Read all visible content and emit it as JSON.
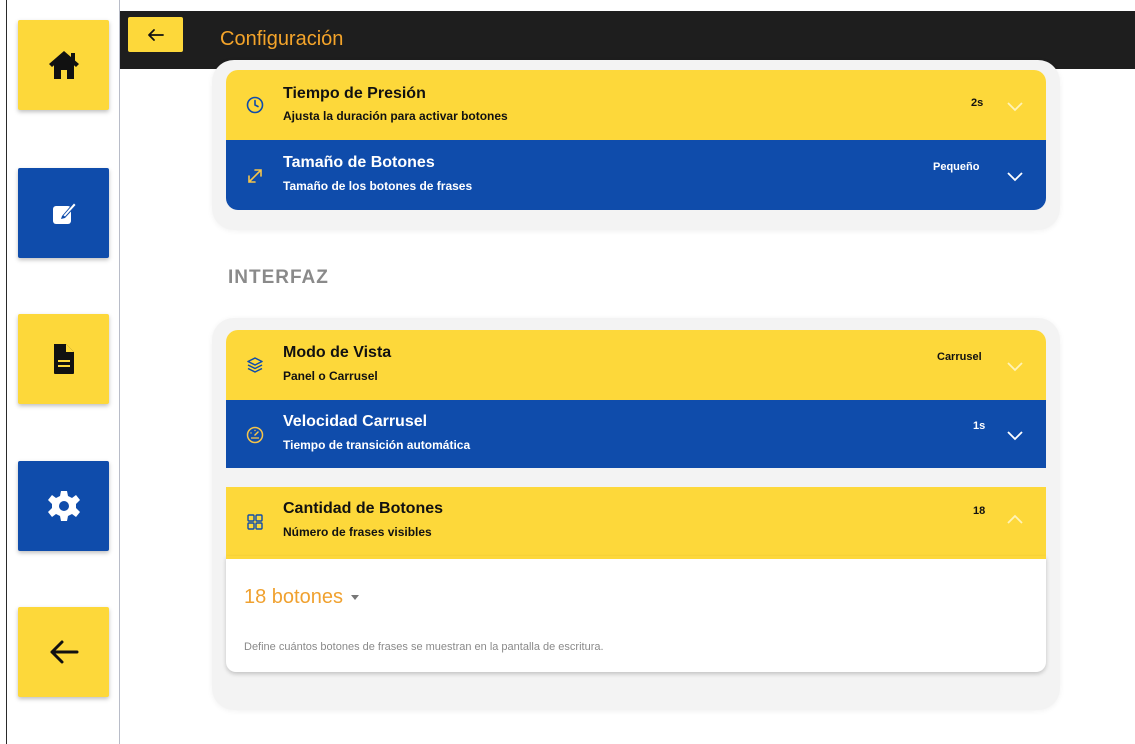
{
  "colors": {
    "accent_yellow": "#fdd83a",
    "accent_blue": "#0f4cab",
    "title_orange": "#f4a42a",
    "topbar": "#1e1e1e"
  },
  "sidebar": {
    "items": [
      {
        "name": "home",
        "icon": "home-icon"
      },
      {
        "name": "edit",
        "icon": "edit-icon"
      },
      {
        "name": "document",
        "icon": "document-icon"
      },
      {
        "name": "settings",
        "icon": "gear-icon"
      },
      {
        "name": "back",
        "icon": "arrow-left-icon"
      }
    ]
  },
  "header": {
    "title": "Configuración",
    "back_icon": "arrow-left-icon"
  },
  "section_top": {
    "rows": [
      {
        "title": "Tiempo de Presión",
        "subtitle": "Ajusta la duración para activar botones",
        "value": "2s",
        "icon": "clock-icon"
      },
      {
        "title": "Tamaño de Botones",
        "subtitle": "Tamaño de los botones de frases",
        "value": "Pequeño",
        "icon": "resize-icon"
      }
    ]
  },
  "section_interfaz": {
    "title": "INTERFAZ",
    "rows": [
      {
        "title": "Modo de Vista",
        "subtitle": "Panel o Carrusel",
        "value": "Carrusel",
        "icon": "layers-icon"
      },
      {
        "title": "Velocidad Carrusel",
        "subtitle": "Tiempo de transición automática",
        "value": "1s",
        "icon": "speedometer-icon"
      },
      {
        "title": "Cantidad de Botones",
        "subtitle": "Número de frases visibles",
        "value": "18",
        "icon": "grid-icon"
      }
    ],
    "expanded": {
      "selected": "18 botones",
      "help": "Define cuántos botones de frases se muestran en la pantalla de escritura."
    }
  }
}
